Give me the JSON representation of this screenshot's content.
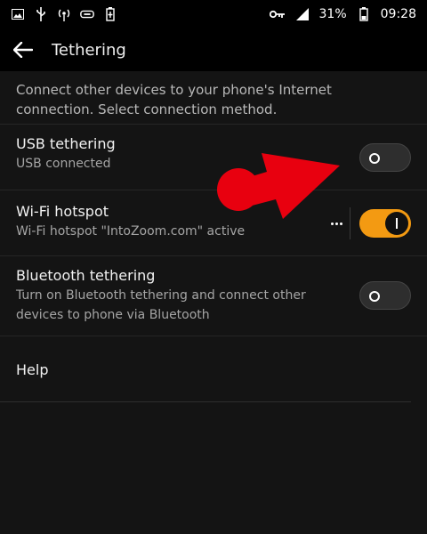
{
  "status_bar": {
    "left_icons": [
      "gallery-icon",
      "usb-icon",
      "hotspot-icon",
      "usb-tether-icon",
      "battery-saver-icon"
    ],
    "right_icons": [
      "key-icon",
      "signal-icon"
    ],
    "battery": "31%",
    "time": "09:28"
  },
  "app_bar": {
    "title": "Tethering"
  },
  "description": "Connect other devices to your phone's Internet connection. Select connection method.",
  "rows": [
    {
      "title": "USB tethering",
      "subtitle": "USB connected",
      "toggle_on": false
    },
    {
      "title": "Wi-Fi hotspot",
      "subtitle": "Wi-Fi hotspot \"IntoZoom.com\" active",
      "toggle_on": true
    },
    {
      "title": "Bluetooth tethering",
      "subtitle": "Turn on Bluetooth tethering and connect other devices to phone via Bluetooth",
      "toggle_on": false
    },
    {
      "title": "Help"
    }
  ],
  "colors": {
    "accent": "#f39a12",
    "annotation": "#e8000f"
  }
}
